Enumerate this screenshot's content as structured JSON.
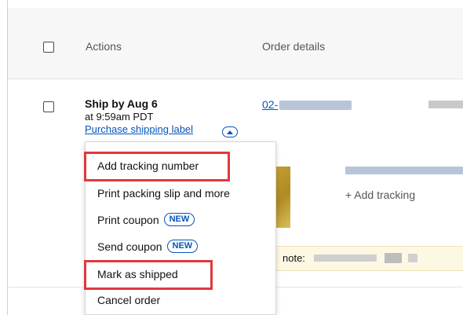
{
  "header": {
    "actions_label": "Actions",
    "order_details_label": "Order details"
  },
  "order": {
    "ship_by": "Ship by Aug 6",
    "ship_time": "at 9:59am PDT",
    "purchase_label_link": "Purchase shipping label",
    "order_number_prefix": "02-",
    "add_tracking": "+ Add tracking",
    "note_label": "note:"
  },
  "menu": {
    "items": [
      {
        "label": "Add tracking number",
        "highlighted": true
      },
      {
        "label": "Print packing slip and more",
        "highlighted": false
      },
      {
        "label": "Print coupon",
        "badge": "NEW",
        "highlighted": false
      },
      {
        "label": "Send coupon",
        "badge": "NEW",
        "highlighted": false
      },
      {
        "label": "Mark as shipped",
        "highlighted": true
      },
      {
        "label": "Cancel order",
        "highlighted": false
      }
    ]
  },
  "colors": {
    "link": "#0654ba",
    "highlight": "#e0393e",
    "note_bg": "#fdf8e3"
  }
}
